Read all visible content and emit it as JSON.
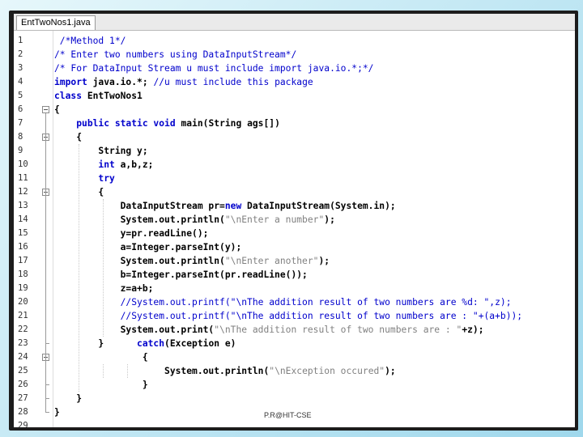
{
  "window": {
    "tab_title": "EntTwoNos1.java"
  },
  "footer": "P.R@HIT-CSE",
  "lines": [
    {
      "n": "1",
      "parts": [
        {
          "t": " /*Method 1*/",
          "c": "cm"
        }
      ]
    },
    {
      "n": "2",
      "parts": [
        {
          "t": "/* Enter two numbers using DataInputStream*/",
          "c": "cm"
        }
      ]
    },
    {
      "n": "3",
      "parts": [
        {
          "t": "/* For DataInput Stream u must include import java.io.*;*/",
          "c": "cm"
        }
      ]
    },
    {
      "n": "4",
      "parts": [
        {
          "t": "import",
          "c": "kw"
        },
        {
          "t": " java.io.*; ",
          "c": ""
        },
        {
          "t": "//u must include this package",
          "c": "cm"
        }
      ]
    },
    {
      "n": "5",
      "parts": [
        {
          "t": "class",
          "c": "kw"
        },
        {
          "t": " EntTwoNos1",
          "c": ""
        }
      ]
    },
    {
      "n": "6",
      "parts": [
        {
          "t": "{",
          "c": ""
        }
      ]
    },
    {
      "n": "7",
      "parts": [
        {
          "t": "    ",
          "c": ""
        },
        {
          "t": "public static void",
          "c": "kw"
        },
        {
          "t": " main(String ags[])",
          "c": ""
        }
      ]
    },
    {
      "n": "8",
      "parts": [
        {
          "t": "    {",
          "c": ""
        }
      ]
    },
    {
      "n": "9",
      "parts": [
        {
          "t": "        String y;",
          "c": ""
        }
      ]
    },
    {
      "n": "10",
      "parts": [
        {
          "t": "        ",
          "c": ""
        },
        {
          "t": "int",
          "c": "kw"
        },
        {
          "t": " a,b,z;",
          "c": ""
        }
      ]
    },
    {
      "n": "11",
      "parts": [
        {
          "t": "        ",
          "c": ""
        },
        {
          "t": "try",
          "c": "kw"
        }
      ]
    },
    {
      "n": "12",
      "parts": [
        {
          "t": "        {",
          "c": ""
        }
      ]
    },
    {
      "n": "13",
      "parts": [
        {
          "t": "            DataInputStream pr=",
          "c": ""
        },
        {
          "t": "new",
          "c": "kw"
        },
        {
          "t": " DataInputStream(System.in);",
          "c": ""
        }
      ]
    },
    {
      "n": "14",
      "parts": [
        {
          "t": "            System.out.println(",
          "c": ""
        },
        {
          "t": "\"\\nEnter a number\"",
          "c": "st"
        },
        {
          "t": ");",
          "c": ""
        }
      ]
    },
    {
      "n": "15",
      "parts": [
        {
          "t": "            y=pr.readLine();",
          "c": ""
        }
      ]
    },
    {
      "n": "16",
      "parts": [
        {
          "t": "            a=Integer.parseInt(y);",
          "c": ""
        }
      ]
    },
    {
      "n": "17",
      "parts": [
        {
          "t": "            System.out.println(",
          "c": ""
        },
        {
          "t": "\"\\nEnter another\"",
          "c": "st"
        },
        {
          "t": ");",
          "c": ""
        }
      ]
    },
    {
      "n": "18",
      "parts": [
        {
          "t": "            b=Integer.parseInt(pr.readLine());",
          "c": ""
        }
      ]
    },
    {
      "n": "19",
      "parts": [
        {
          "t": "            z=a+b;",
          "c": ""
        }
      ]
    },
    {
      "n": "20",
      "parts": [
        {
          "t": "            //System.out.printf(\"\\nThe addition result of two numbers are %d: \",z);",
          "c": "cm"
        }
      ]
    },
    {
      "n": "21",
      "parts": [
        {
          "t": "            //System.out.printf(\"\\nThe addition result of two numbers are : \"+(a+b));",
          "c": "cm"
        }
      ]
    },
    {
      "n": "22",
      "parts": [
        {
          "t": "            System.out.print(",
          "c": ""
        },
        {
          "t": "\"\\nThe addition result of two numbers are : \"",
          "c": "st"
        },
        {
          "t": "+z);",
          "c": ""
        }
      ]
    },
    {
      "n": "23",
      "parts": [
        {
          "t": "        }      ",
          "c": ""
        },
        {
          "t": "catch",
          "c": "kw"
        },
        {
          "t": "(Exception e)",
          "c": ""
        }
      ]
    },
    {
      "n": "24",
      "parts": [
        {
          "t": "                {",
          "c": ""
        }
      ]
    },
    {
      "n": "25",
      "parts": [
        {
          "t": "                    System.out.println(",
          "c": ""
        },
        {
          "t": "\"\\nException occured\"",
          "c": "st"
        },
        {
          "t": ");",
          "c": ""
        }
      ]
    },
    {
      "n": "26",
      "parts": [
        {
          "t": "                }",
          "c": ""
        }
      ]
    },
    {
      "n": "27",
      "parts": [
        {
          "t": "    }",
          "c": ""
        }
      ]
    },
    {
      "n": "28",
      "parts": [
        {
          "t": "}",
          "c": ""
        }
      ]
    },
    {
      "n": "29",
      "parts": []
    }
  ]
}
